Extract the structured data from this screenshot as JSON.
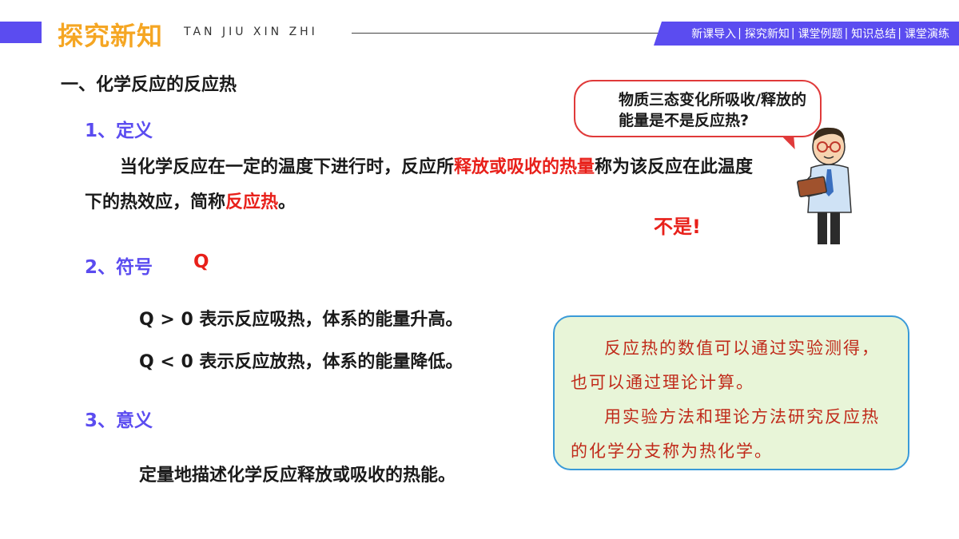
{
  "header": {
    "title": "探究新知",
    "subtitle": "TAN JIU XIN ZHI",
    "nav": [
      "新课导入",
      "探究新知",
      "课堂例题",
      "知识总结",
      "课堂演练"
    ]
  },
  "section_title": "一、化学反应的反应热",
  "definition": {
    "heading": "1、定义",
    "text_a": "当化学反应在一定的温度下进行时，反应所",
    "text_highlight": "释放或吸收的热量",
    "text_b": "称为该反应在此温度",
    "text_c": "下的热效应，简称",
    "text_highlight2": "反应热",
    "text_d": "。"
  },
  "symbol": {
    "heading": "2、符号",
    "value": "Q",
    "positive": "Q > 0  表示反应吸热，体系的能量升高。",
    "negative": "Q < 0  表示反应放热，体系的能量降低。"
  },
  "meaning": {
    "heading": "3、意义",
    "text": "定量地描述化学反应释放或吸收的热能。"
  },
  "bubble": {
    "text": "物质三态变化所吸收/释放的能量是不是反应热?",
    "answer": "不是!"
  },
  "note": {
    "line1": "反应热的数值可以通过实验测得，也可以通过理论计算。",
    "line2": "用实验方法和理论方法研究反应热的化学分支称为热化学。"
  },
  "colors": {
    "accent": "#5b4cf0",
    "title": "#f5a623",
    "highlight": "#e8201a"
  }
}
